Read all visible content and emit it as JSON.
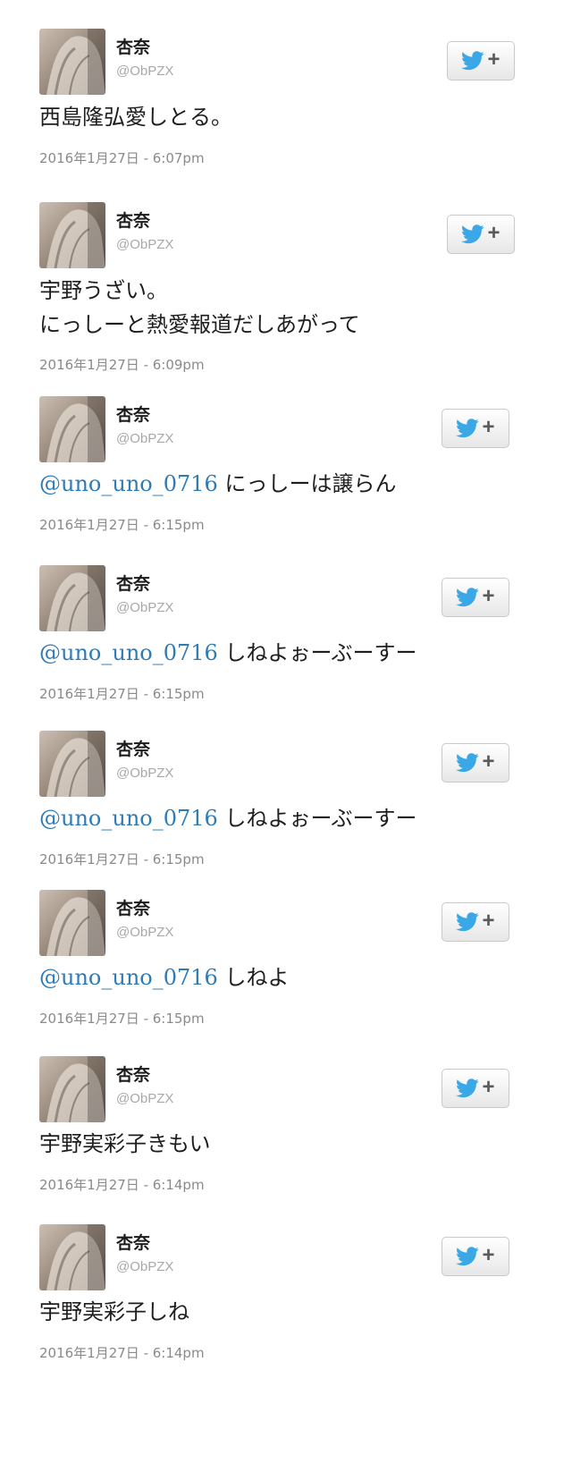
{
  "colors": {
    "mention": "#2f7bb6",
    "bird": "#3aa8e6",
    "text": "#1e1e1e",
    "meta": "#8a8a8a"
  },
  "icons": {
    "follow": "twitter-bird-icon",
    "plus": "+"
  },
  "tweets": [
    {
      "name": "杏奈",
      "handle": "@ObPZX",
      "mention": "",
      "text_lines": [
        "西島隆弘愛しとる。"
      ],
      "timestamp": "2016年1月27日 - 6:07pm"
    },
    {
      "name": "杏奈",
      "handle": "@ObPZX",
      "mention": "",
      "text_lines": [
        "宇野うざい。",
        "にっしーと熱愛報道だしあがって"
      ],
      "timestamp": "2016年1月27日 - 6:09pm"
    },
    {
      "name": "杏奈",
      "handle": "@ObPZX",
      "mention": "@uno_uno_0716",
      "text_lines": [
        "にっしーは譲らん"
      ],
      "timestamp": "2016年1月27日 - 6:15pm"
    },
    {
      "name": "杏奈",
      "handle": "@ObPZX",
      "mention": "@uno_uno_0716",
      "text_lines": [
        "しねよぉーぶーすー"
      ],
      "timestamp": "2016年1月27日 - 6:15pm"
    },
    {
      "name": "杏奈",
      "handle": "@ObPZX",
      "mention": "@uno_uno_0716",
      "text_lines": [
        "しねよぉーぶーすー"
      ],
      "timestamp": "2016年1月27日 - 6:15pm"
    },
    {
      "name": "杏奈",
      "handle": "@ObPZX",
      "mention": "@uno_uno_0716",
      "text_lines": [
        "しねよ"
      ],
      "timestamp": "2016年1月27日 - 6:15pm"
    },
    {
      "name": "杏奈",
      "handle": "@ObPZX",
      "mention": "",
      "text_lines": [
        "宇野実彩子きもい"
      ],
      "timestamp": "2016年1月27日 - 6:14pm"
    },
    {
      "name": "杏奈",
      "handle": "@ObPZX",
      "mention": "",
      "text_lines": [
        "宇野実彩子しね"
      ],
      "timestamp": "2016年1月27日 - 6:14pm"
    }
  ]
}
